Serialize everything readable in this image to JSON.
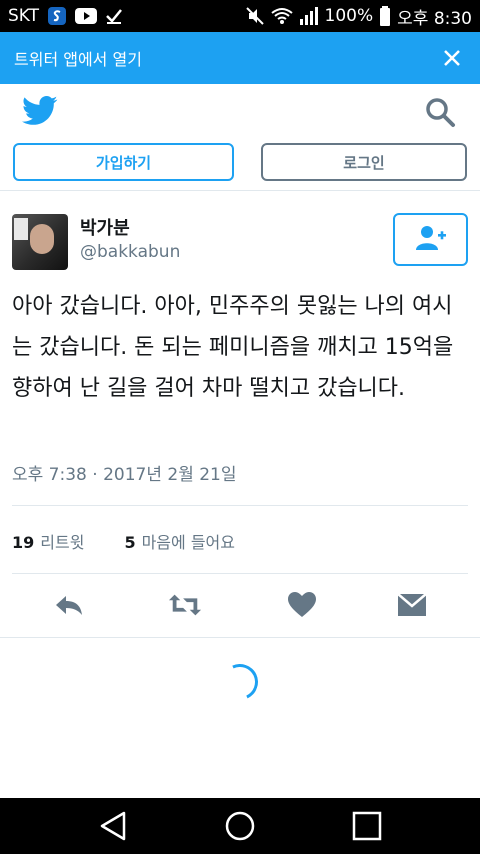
{
  "status_bar": {
    "carrier": "SKT",
    "battery": "100%",
    "time": "오후 8:30"
  },
  "banner": {
    "text": "트위터 앱에서 열기"
  },
  "buttons": {
    "signup": "가입하기",
    "login": "로그인"
  },
  "tweet": {
    "author_name": "박가분",
    "author_handle": "@bakkabun",
    "text": "아아 갔습니다. 아아, 민주주의 못잃는 나의 여시는 갔습니다. 돈 되는 페미니즘을 깨치고 15억을 향하여 난 길을 걸어 차마 떨치고 갔습니다.",
    "timestamp": "오후 7:38 · 2017년 2월 21일",
    "retweet_count": "19",
    "retweet_label": "리트윗",
    "like_count": "5",
    "like_label": "마음에 들어요"
  },
  "colors": {
    "brand": "#1da1f2",
    "text_primary": "#14171a",
    "text_secondary": "#657786",
    "divider": "#e1e8ed"
  },
  "icons": [
    "twitter-bird-icon",
    "search-icon",
    "close-icon",
    "follow-user-icon",
    "reply-icon",
    "retweet-icon",
    "like-icon",
    "direct-message-icon",
    "back-nav-icon",
    "home-nav-icon",
    "recents-nav-icon"
  ]
}
